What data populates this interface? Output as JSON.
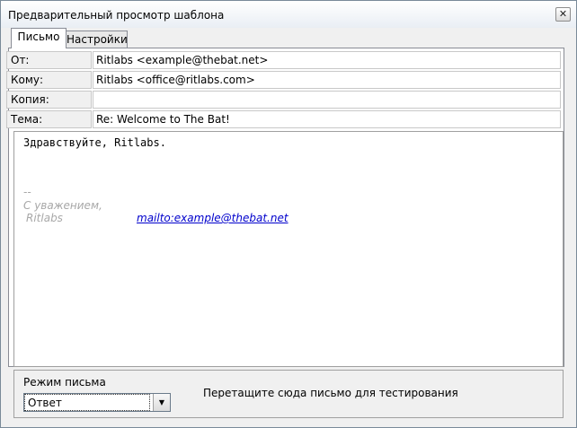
{
  "window": {
    "title": "Предварительный просмотр шаблона",
    "close_glyph": "✕"
  },
  "tabs": [
    {
      "label": "Письмо",
      "active": true
    },
    {
      "label": "Настройки",
      "active": false
    }
  ],
  "fields": [
    {
      "label": "От:",
      "value": "Ritlabs <example@thebat.net>"
    },
    {
      "label": "Кому:",
      "value": "Ritlabs <office@ritlabs.com>"
    },
    {
      "label": "Копия:",
      "value": ""
    },
    {
      "label": "Тема:",
      "value": "Re: Welcome to The Bat!"
    }
  ],
  "body": {
    "greeting": "Здравствуйте, Ritlabs.",
    "signature_separator": "--",
    "signature_closing": "С уважением,",
    "signature_name": "Ritlabs",
    "mailto_link": "mailto:example@thebat.net"
  },
  "footer": {
    "mode_label": "Режим письма",
    "mode_value": "Ответ",
    "drop_hint": "Перетащите сюда письмо для тестирования"
  },
  "colors": {
    "link": "#0000cc",
    "signature": "#a8a8a8"
  }
}
